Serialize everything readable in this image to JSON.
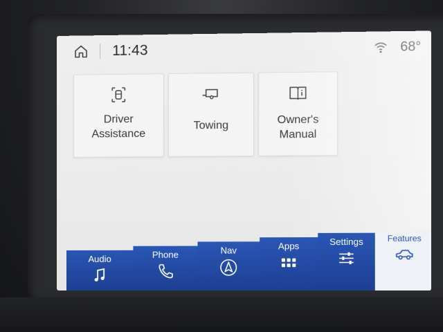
{
  "status": {
    "time": "11:43",
    "temperature": "68°",
    "icons": [
      "home-icon",
      "wifi-icon"
    ]
  },
  "tiles": [
    {
      "label_line1": "Driver",
      "label_line2": "Assistance",
      "icon": "driver-assist-icon"
    },
    {
      "label": "Towing",
      "icon": "trailer-icon"
    },
    {
      "label": "Owner's Manual",
      "icon": "book-icon"
    }
  ],
  "nav": {
    "audio": "Audio",
    "phone": "Phone",
    "nav": "Nav",
    "apps": "Apps",
    "settings": "Settings",
    "features": "Features",
    "selected": "Features"
  },
  "colors": {
    "nav_bar": "#2a56b5",
    "selected_tab_text": "#2a56b5",
    "screen_bg": "#eeeeee"
  }
}
